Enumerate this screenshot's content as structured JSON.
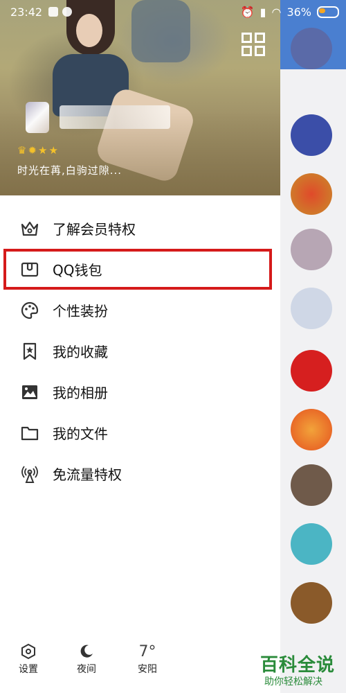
{
  "status_bar": {
    "time": "23:42",
    "battery": "36%"
  },
  "profile": {
    "signature": "时光在苒,白驹过隙...",
    "badges": [
      "♛",
      "✹",
      "★",
      "★"
    ]
  },
  "menu": {
    "items": [
      {
        "label": "了解会员特权",
        "icon": "crown-icon"
      },
      {
        "label": "QQ钱包",
        "icon": "wallet-icon"
      },
      {
        "label": "个性装扮",
        "icon": "palette-icon"
      },
      {
        "label": "我的收藏",
        "icon": "bookmark-star-icon"
      },
      {
        "label": "我的相册",
        "icon": "image-icon"
      },
      {
        "label": "我的文件",
        "icon": "folder-icon"
      },
      {
        "label": "免流量特权",
        "icon": "antenna-icon"
      }
    ],
    "highlight_color": "#d51a1a"
  },
  "bottom": {
    "settings_label": "设置",
    "night_label": "夜间",
    "weather_temp": "7°",
    "weather_city": "安阳"
  },
  "watermark": {
    "title": "百科全说",
    "subtitle": "助你轻松解决"
  }
}
